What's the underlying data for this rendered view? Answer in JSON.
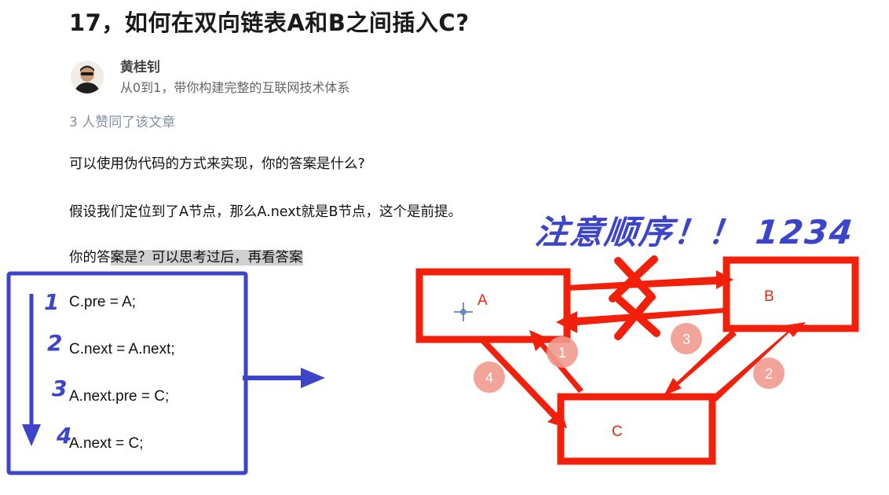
{
  "article": {
    "title": "17，如何在双向链表A和B之间插入C?",
    "author_name": "黄桂钊",
    "author_bio": "从0到1，带你构建完整的互联网技术体系",
    "likes": "3 人赞同了该文章",
    "paragraphs": [
      "可以使用伪代码的方式来实现，你的答案是什么?",
      "假设我们定位到了A节点，那么A.next就是B节点，这个是前提。"
    ],
    "answer_prompt_plain": "你的答",
    "answer_prompt_highlight": "案是？可以思考过后，再看答案"
  },
  "annotations": {
    "headline": "注意顺序！！ 1234",
    "step_numbers": [
      "1",
      "2",
      "3",
      "4"
    ],
    "badges": [
      "1",
      "2",
      "3",
      "4"
    ]
  },
  "code": {
    "lines": [
      "C.pre = A;",
      "C.next = A.next;",
      "A.next.pre = C;",
      "A.next = C;"
    ]
  },
  "diagram": {
    "nodes": [
      {
        "id": "A",
        "label": "A"
      },
      {
        "id": "B",
        "label": "B"
      },
      {
        "id": "C",
        "label": "C"
      }
    ]
  },
  "colors": {
    "annotation_blue": "#3c44c9",
    "arrow_red": "#f2200a",
    "badge_pink": "#f29a8e",
    "highlight_gray": "#d0d0d0"
  }
}
